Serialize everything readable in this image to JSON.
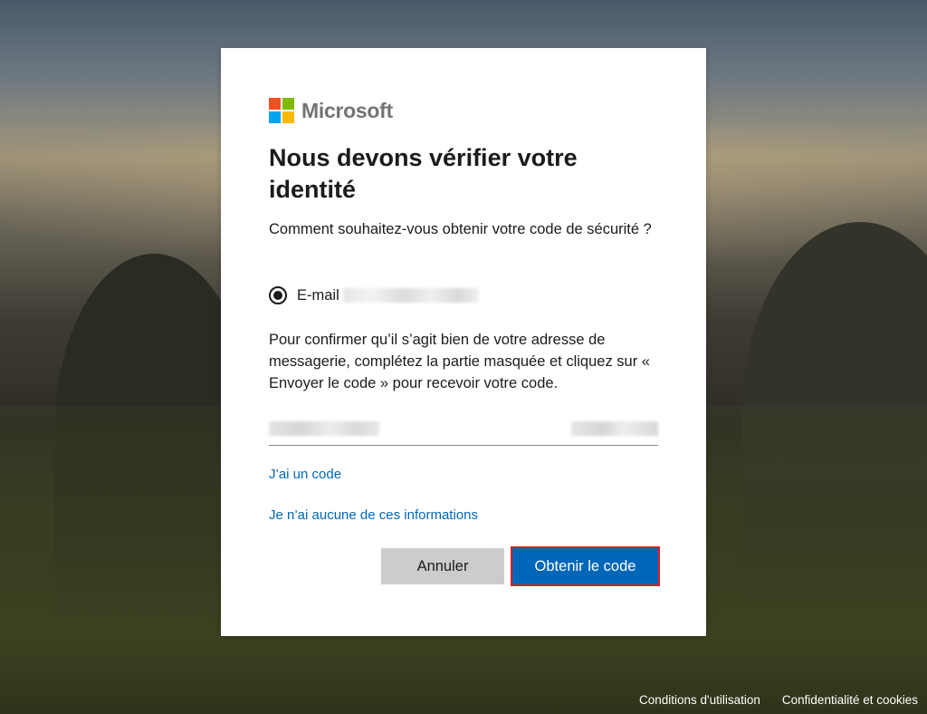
{
  "brand": {
    "name": "Microsoft",
    "logo_colors": [
      "#f25022",
      "#7fba00",
      "#00a4ef",
      "#ffb900"
    ]
  },
  "dialog": {
    "title": "Nous devons vérifier votre identité",
    "subtitle": "Comment souhaitez-vous obtenir votre code de sécurité ?",
    "option": {
      "label": "E-mail",
      "selected": true
    },
    "description": "Pour confirmer qu’il s’agit bien de votre adresse de messagerie, complétez la partie masquée et cliquez sur « Envoyer le code » pour recevoir votre code.",
    "links": {
      "have_code": "J’ai un code",
      "no_info": "Je n’ai aucune de ces informations"
    },
    "buttons": {
      "cancel": "Annuler",
      "submit": "Obtenir le code"
    }
  },
  "footer": {
    "terms": "Conditions d'utilisation",
    "privacy": "Confidentialité et cookies"
  },
  "colors": {
    "accent": "#0067b8",
    "highlight_border": "#e01b24",
    "cancel_bg": "#cccccc"
  }
}
